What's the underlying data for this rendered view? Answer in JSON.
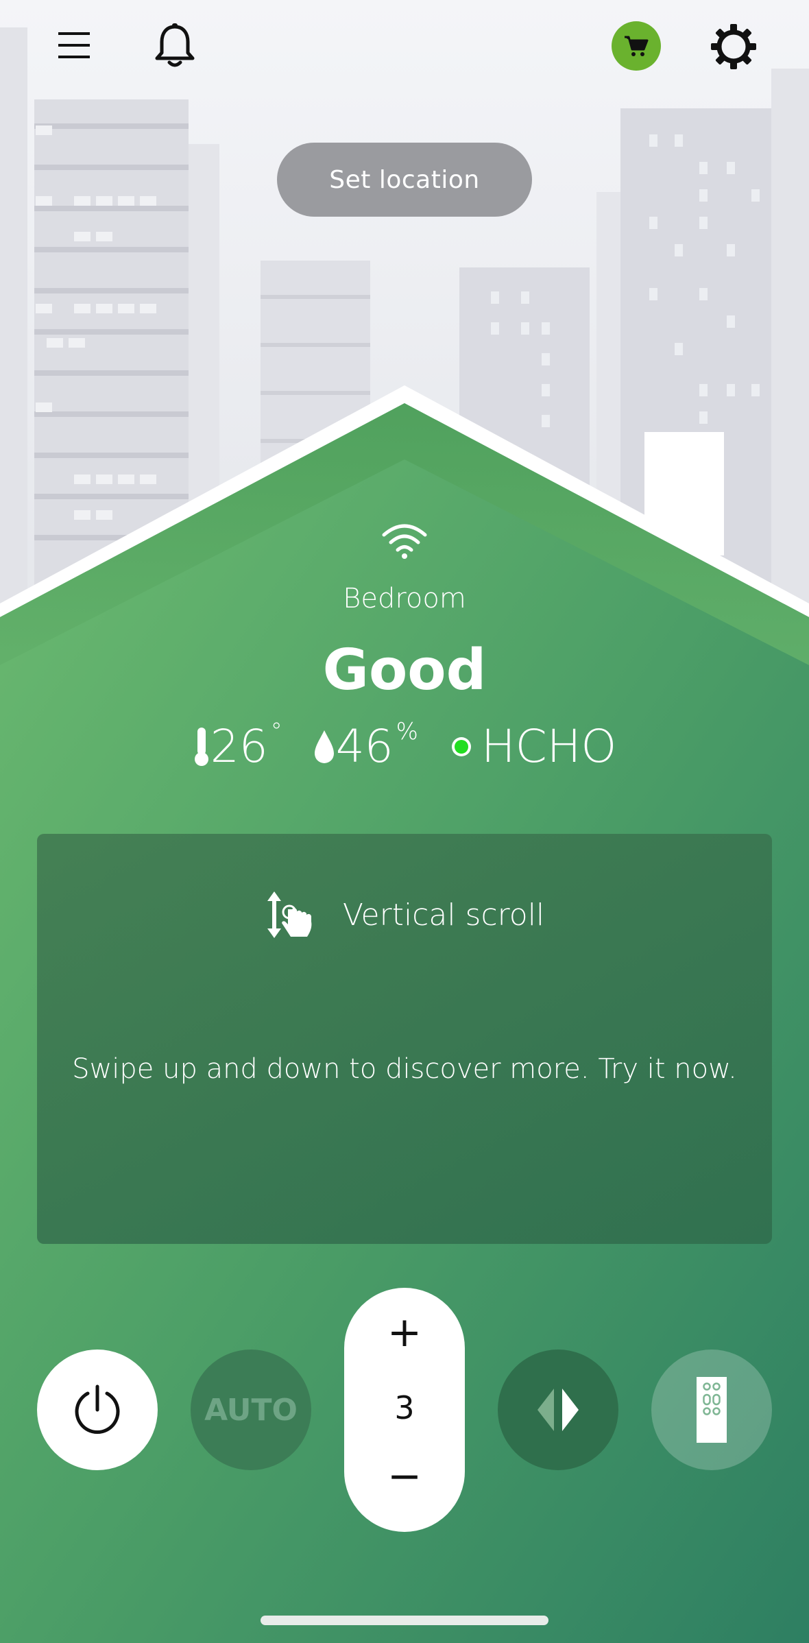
{
  "header": {
    "menu_icon": "menu-icon",
    "notification_icon": "bell-icon",
    "cart_icon": "cart-icon",
    "settings_icon": "gear-icon",
    "location_button_label": "Set location"
  },
  "device": {
    "connection_icon": "wifi-icon",
    "room": "Bedroom",
    "air_quality": "Good",
    "temperature": "26",
    "temperature_unit": "°",
    "humidity": "46",
    "humidity_unit": "%",
    "hcho_label": "HCHO",
    "hcho_status_color": "#22dd22"
  },
  "tip": {
    "title": "Vertical scroll",
    "body": "Swipe up and down to discover more. Try it now."
  },
  "controls": {
    "auto_label": "AUTO",
    "speed_plus": "+",
    "speed_value": "3",
    "speed_minus": "−"
  },
  "colors": {
    "accent_green": "#5fb16a",
    "cart_badge": "#6ab22e"
  }
}
